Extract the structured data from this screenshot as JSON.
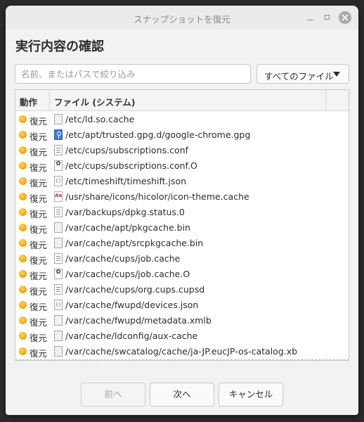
{
  "window": {
    "title": "スナップショットを復元"
  },
  "heading": "実行内容の確認",
  "search": {
    "placeholder": "名前、またはパスで絞り込み",
    "value": ""
  },
  "filter": {
    "selected": "すべてのファイル"
  },
  "table": {
    "columns": [
      "動作",
      "ファイル (システム)"
    ],
    "rows": [
      {
        "action": "復元",
        "icon": "generic-file-icon",
        "path": "/etc/ld.so.cache"
      },
      {
        "action": "復元",
        "icon": "key-file-icon",
        "path": "/etc/apt/trusted.gpg.d/google-chrome.gpg"
      },
      {
        "action": "復元",
        "icon": "text-file-icon",
        "path": "/etc/cups/subscriptions.conf"
      },
      {
        "action": "復元",
        "icon": "gear-file-icon",
        "path": "/etc/cups/subscriptions.conf.O"
      },
      {
        "action": "復元",
        "icon": "json-file-icon",
        "path": "/etc/timeshift/timeshift.json"
      },
      {
        "action": "復元",
        "icon": "font-file-icon",
        "path": "/usr/share/icons/hicolor/icon-theme.cache"
      },
      {
        "action": "復元",
        "icon": "text-file-icon",
        "path": "/var/backups/dpkg.status.0"
      },
      {
        "action": "復元",
        "icon": "generic-file-icon",
        "path": "/var/cache/apt/pkgcache.bin"
      },
      {
        "action": "復元",
        "icon": "generic-file-icon",
        "path": "/var/cache/apt/srcpkgcache.bin"
      },
      {
        "action": "復元",
        "icon": "text-file-icon",
        "path": "/var/cache/cups/job.cache"
      },
      {
        "action": "復元",
        "icon": "gear-file-icon",
        "path": "/var/cache/cups/job.cache.O"
      },
      {
        "action": "復元",
        "icon": "text-file-icon",
        "path": "/var/cache/cups/org.cups.cupsd"
      },
      {
        "action": "復元",
        "icon": "json-file-icon",
        "path": "/var/cache/fwupd/devices.json"
      },
      {
        "action": "復元",
        "icon": "generic-file-icon",
        "path": "/var/cache/fwupd/metadata.xmlb"
      },
      {
        "action": "復元",
        "icon": "generic-file-icon",
        "path": "/var/cache/ldconfig/aux-cache"
      },
      {
        "action": "復元",
        "icon": "generic-file-icon",
        "path": "/var/cache/swcatalog/cache/ja-JP.eucJP-os-catalog.xb"
      }
    ]
  },
  "buttons": {
    "prev": "前へ",
    "next": "次へ",
    "cancel": "キャンセル"
  },
  "colors": {
    "status_dot": "#f0a500",
    "window_bg": "#f2f2f2",
    "desktop_bg": "#2b2b2b"
  }
}
